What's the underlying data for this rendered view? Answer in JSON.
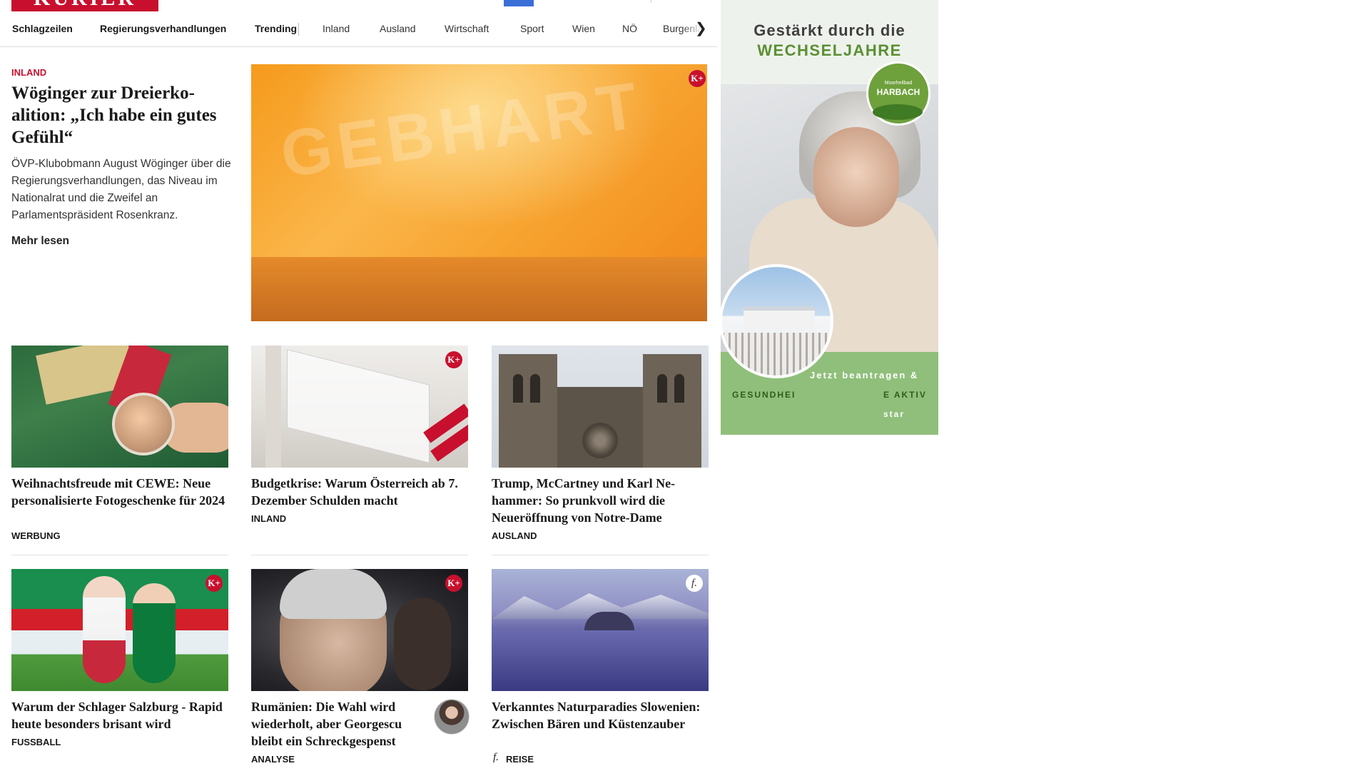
{
  "brand": {
    "logo_text": "KURIER",
    "accent": "#c8102e"
  },
  "nav": {
    "items": [
      {
        "label": "Schlagzeilen",
        "bold": true
      },
      {
        "label": "Regierungsverhandlungen",
        "bold": true
      },
      {
        "label": "Trending",
        "bold": true
      },
      {
        "label": "Inland"
      },
      {
        "label": "Ausland"
      },
      {
        "label": "Wirtschaft"
      },
      {
        "label": "Sport"
      },
      {
        "label": "Wien"
      },
      {
        "label": "NÖ"
      },
      {
        "label": "Burgenland"
      }
    ],
    "chevron_icon": "chevron-right-icon"
  },
  "hero": {
    "kicker": "INLAND",
    "title": "Wöginger zur Dreierko­alition: „Ich habe ein gu­tes Gefühl“",
    "teaser": "ÖVP-Klubobmann August Wöginger über die Regierungsverhandlungen, das Niveau im Nationalrat und die Zweifel an Parlamentspräsident Rosenkranz.",
    "more": "Mehr lesen",
    "image_watermark": "GEBHART",
    "badge": "K+"
  },
  "articles": [
    {
      "title": "Weihnachtsfreude mit CEWE: Neue personalisierte Fotogeschenke für 2024",
      "kicker": "WERBUNG"
    },
    {
      "title": "Budgetkrise: Warum Österreich ab 7. Dezember Schulden macht",
      "kicker": "INLAND",
      "badge": "K+"
    },
    {
      "title": "Trump, McCartney und Karl Ne­hammer: So prunkvoll wird die Neueröffnung von Notre-Dame",
      "kicker": "AUSLAND"
    },
    {
      "title": "Warum der Schlager Salzburg - Rapid heute besonders brisant wird",
      "kicker": "FUSSBALL",
      "badge": "K+"
    },
    {
      "title": "Rumänien: Die Wahl wird wiederholt, aber Georgescu bleibt ein Schreckgespenst",
      "kicker": "ANALYSE",
      "badge": "K+"
    },
    {
      "title": "Verkanntes Naturparadies Slowe­nien: Zwischen Bären und Küstenzauber",
      "kicker": "REISE",
      "badge": "f."
    }
  ],
  "ad": {
    "line1": "Gestärkt durch die",
    "line2": "WECHSELJAHRE",
    "badge_small": "Moorheilbad",
    "badge_big": "HARBACH",
    "bottom1": "Jetzt beantragen &",
    "bottom2": "GESUNDHEI",
    "bottom3": "E AKTIV",
    "bottom4": "star"
  }
}
